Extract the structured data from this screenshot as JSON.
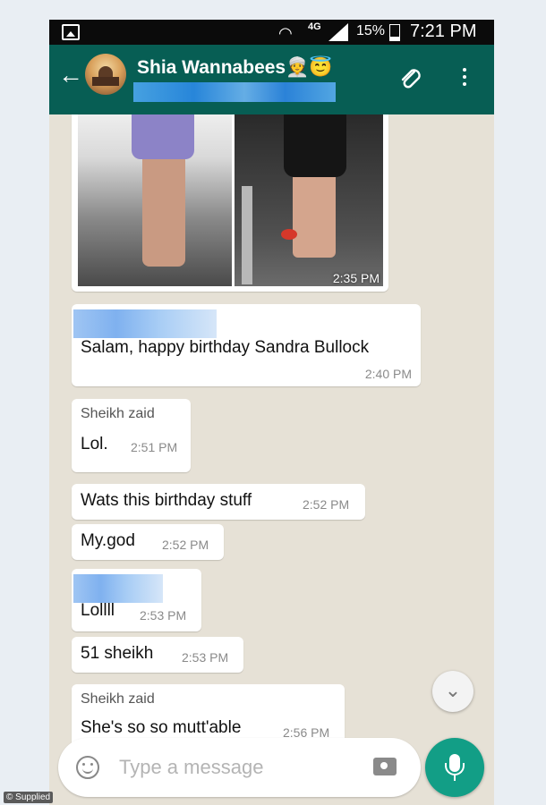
{
  "status_bar": {
    "network": "4G",
    "battery": "15%",
    "clock": "7:21 PM"
  },
  "header": {
    "title": "Shia Wannabees👳😇"
  },
  "photo_message": {
    "time": "2:35 PM"
  },
  "messages": [
    {
      "text": "Salam, happy birthday Sandra Bullock",
      "time": "2:40 PM"
    },
    {
      "sender": "Sheikh zaid",
      "text": "Lol.",
      "time": "2:51 PM"
    },
    {
      "text": "Wats this birthday stuff",
      "time": "2:52 PM"
    },
    {
      "text": "My.god",
      "time": "2:52 PM"
    },
    {
      "text": "Lollll",
      "time": "2:53 PM"
    },
    {
      "text": "51 sheikh",
      "time": "2:53 PM"
    },
    {
      "sender": "Sheikh zaid",
      "text": "She's so so mutt'able",
      "time": "2:56 PM"
    }
  ],
  "input": {
    "placeholder": "Type a message"
  },
  "credit": "© Supplied",
  "colors": {
    "header": "#075e54",
    "mic": "#129e86",
    "chat_bg": "#e6e1d6"
  },
  "icons": [
    "image-icon",
    "wifi-icon",
    "signal-icon",
    "battery-icon",
    "back-arrow-icon",
    "paperclip-icon",
    "more-vert-icon",
    "chevron-down-icon",
    "emoji-icon",
    "camera-icon",
    "mic-icon"
  ]
}
